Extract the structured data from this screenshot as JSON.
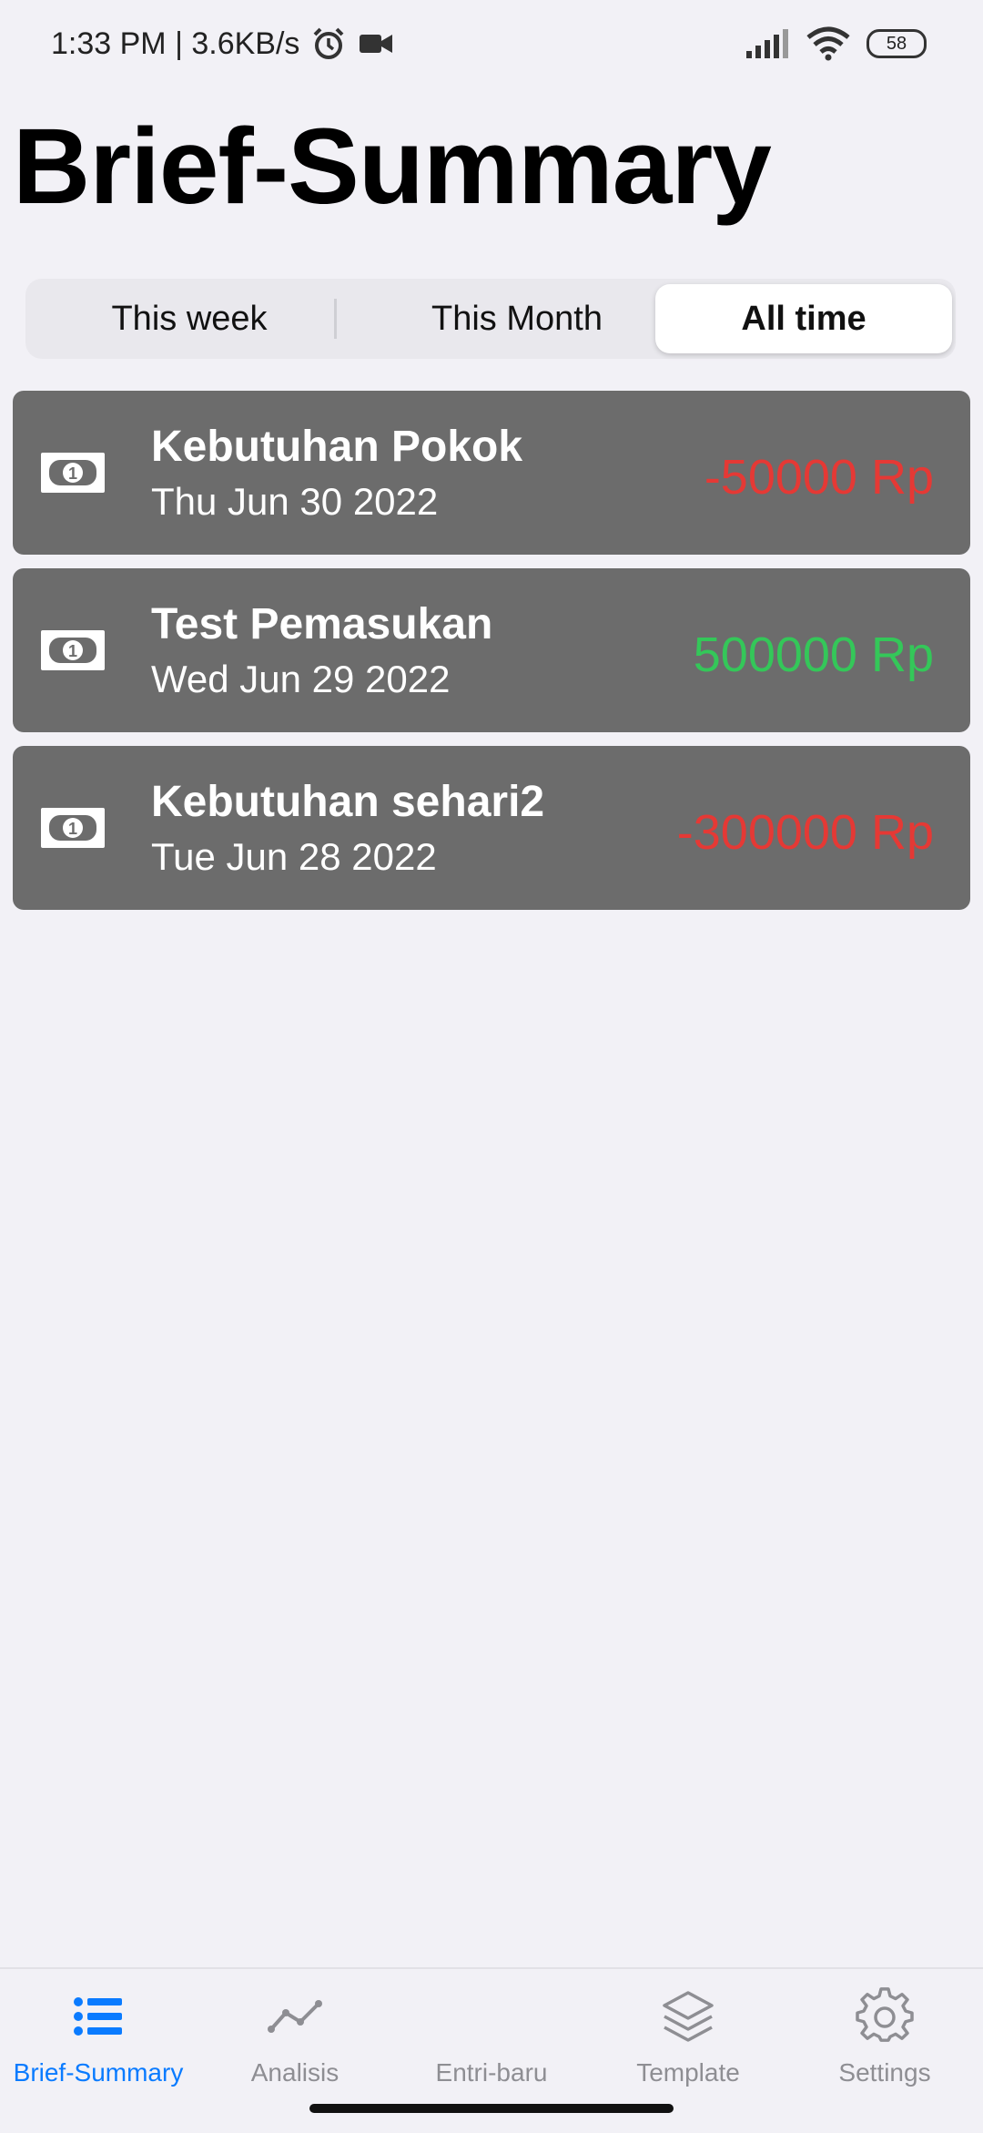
{
  "status_bar": {
    "time_speed": "1:33 PM | 3.6KB/s",
    "battery": "58"
  },
  "page": {
    "title": "Brief-Summary"
  },
  "segmented": {
    "options": [
      "This week",
      "This Month",
      "All time"
    ],
    "selected": "All time"
  },
  "transactions": [
    {
      "title": "Kebutuhan Pokok",
      "date": "Thu Jun 30 2022",
      "amount": "-50000 Rp",
      "type": "expense"
    },
    {
      "title": "Test Pemasukan",
      "date": "Wed Jun 29 2022",
      "amount": "500000 Rp",
      "type": "income"
    },
    {
      "title": "Kebutuhan sehari2",
      "date": "Tue Jun 28 2022",
      "amount": "-300000 Rp",
      "type": "expense"
    }
  ],
  "tabbar": {
    "items": [
      {
        "label": "Brief-Summary",
        "icon": "list-icon",
        "active": true
      },
      {
        "label": "Analisis",
        "icon": "chart-line-icon",
        "active": false
      },
      {
        "label": "Entri-baru",
        "icon": "",
        "active": false
      },
      {
        "label": "Template",
        "icon": "layers-icon",
        "active": false
      },
      {
        "label": "Settings",
        "icon": "gear-icon",
        "active": false
      }
    ]
  },
  "colors": {
    "expense": "#e53935",
    "income": "#34c759",
    "accent": "#0a7bff",
    "card": "#6c6c6c"
  }
}
